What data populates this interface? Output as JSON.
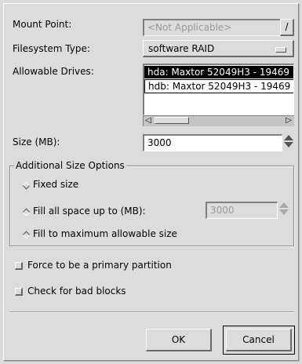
{
  "dialog": {
    "mount_point": {
      "label": "Mount Point:",
      "value": "<Not Applicable>",
      "dropdown_glyph": "/"
    },
    "fs_type": {
      "label": "Filesystem Type:",
      "value": "software RAID"
    },
    "drives": {
      "label": "Allowable Drives:",
      "items": [
        {
          "text": "hda: Maxtor 52049H3 - 19469",
          "selected": true
        },
        {
          "text": "hdb: Maxtor 52049H3 - 19469",
          "selected": false
        }
      ]
    },
    "size": {
      "label": "Size (MB):",
      "value": "3000"
    },
    "additional": {
      "title": "Additional Size Options",
      "fixed_label": "Fixed size",
      "fill_upto_label": "Fill all space up to (MB):",
      "fill_upto_value": "3000",
      "fill_max_label": "Fill to maximum allowable size"
    },
    "force_primary_label": "Force to be a primary partition",
    "bad_blocks_label": "Check for bad blocks",
    "ok_label": "OK",
    "cancel_label": "Cancel"
  }
}
